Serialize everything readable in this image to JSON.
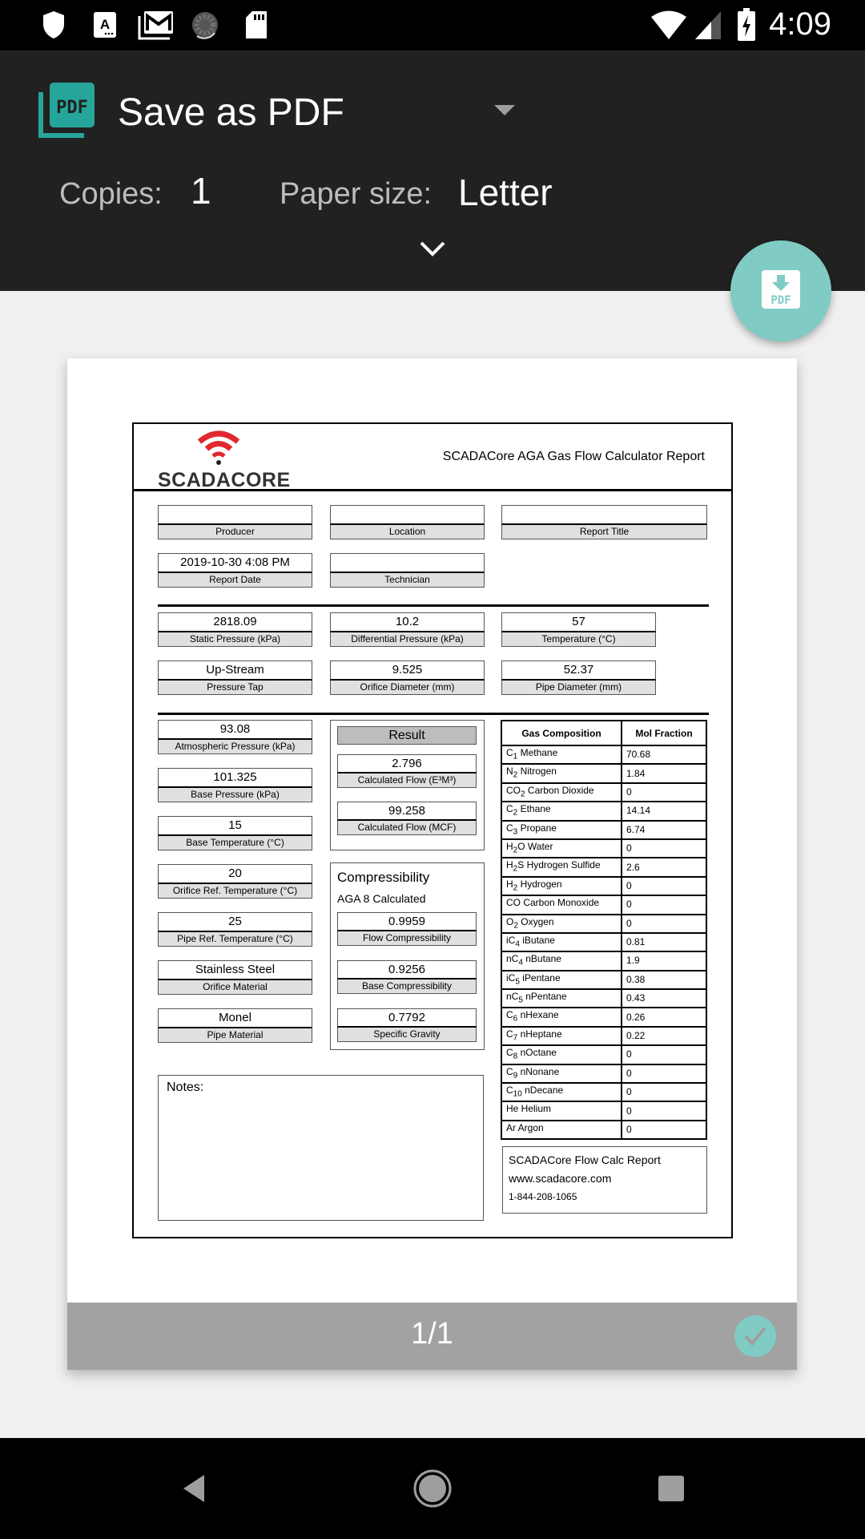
{
  "status_bar": {
    "time": "4:09",
    "left_icons": [
      "shield-icon",
      "font-a-icon",
      "gmail-icon",
      "sync-progress-icon",
      "sd-card-icon"
    ],
    "right_icons": [
      "wifi-icon",
      "cell-signal-icon",
      "battery-charging-icon"
    ]
  },
  "print_header": {
    "printer_name": "Save as PDF",
    "copies_label": "Copies:",
    "copies_value": "1",
    "paper_size_label": "Paper size:",
    "paper_size_value": "Letter",
    "fab_label": "PDF"
  },
  "colors": {
    "accent": "#80cbc4",
    "header_bg": "#212121",
    "pdf_icon": "#26a69a",
    "logo_red": "#e0282e"
  },
  "report": {
    "logo_text": "SCADACORE",
    "title": "SCADACore AGA Gas Flow Calculator Report",
    "info_fields": [
      {
        "value": "",
        "label": "Producer"
      },
      {
        "value": "",
        "label": "Location"
      },
      {
        "value": "",
        "label": "Report Title"
      },
      {
        "value": "2019-10-30  4:08 PM",
        "label": "Report Date"
      },
      {
        "value": "",
        "label": "Technician"
      }
    ],
    "measurement_fields": [
      {
        "value": "2818.09",
        "label": "Static Pressure (kPa)"
      },
      {
        "value": "10.2",
        "label": "Differential Pressure (kPa)"
      },
      {
        "value": "57",
        "label": "Temperature (°C)"
      },
      {
        "value": "Up-Stream",
        "label": "Pressure Tap"
      },
      {
        "value": "9.525",
        "label": "Orifice Diameter (mm)"
      },
      {
        "value": "52.37",
        "label": "Pipe Diameter (mm)"
      }
    ],
    "base_fields": [
      {
        "value": "93.08",
        "label": "Atmospheric Pressure (kPa)"
      },
      {
        "value": "101.325",
        "label": "Base Pressure (kPa)"
      },
      {
        "value": "15",
        "label": "Base Temperature (°C)"
      },
      {
        "value": "20",
        "label": "Orifice Ref. Temperature (°C)"
      },
      {
        "value": "25",
        "label": "Pipe Ref. Temperature (°C)"
      },
      {
        "value": "Stainless Steel",
        "label": "Orifice Material"
      },
      {
        "value": "Monel",
        "label": "Pipe Material"
      }
    ],
    "result": {
      "heading": "Result",
      "fields": [
        {
          "value": "2.796",
          "label": "Calculated Flow (E³M³)"
        },
        {
          "value": "99.258",
          "label": "Calculated Flow (MCF)"
        }
      ]
    },
    "compressibility": {
      "heading": "Compressibility",
      "subheading": "AGA 8 Calculated",
      "fields": [
        {
          "value": "0.9959",
          "label": "Flow Compressibility"
        },
        {
          "value": "0.9256",
          "label": "Base Compressibility"
        },
        {
          "value": "0.7792",
          "label": "Specific Gravity"
        }
      ]
    },
    "gas_table": {
      "headers": [
        "Gas Composition",
        "Mol Fraction"
      ],
      "rows": [
        {
          "sym": "C",
          "sub": "1",
          "name": " Methane",
          "value": "70.68"
        },
        {
          "sym": "N",
          "sub": "2",
          "name": " Nitrogen",
          "value": "1.84"
        },
        {
          "sym": "CO",
          "sub": "2",
          "name": " Carbon Dioxide",
          "value": "0"
        },
        {
          "sym": "C",
          "sub": "2",
          "name": " Ethane",
          "value": "14.14"
        },
        {
          "sym": "C",
          "sub": "3",
          "name": " Propane",
          "value": "6.74"
        },
        {
          "sym": "H",
          "sub": "2",
          "name": "O Water",
          "value": "0"
        },
        {
          "sym": "H",
          "sub": "2",
          "name": "S Hydrogen Sulfide",
          "value": "2.6"
        },
        {
          "sym": "H",
          "sub": "2",
          "name": " Hydrogen",
          "value": "0"
        },
        {
          "sym": "CO",
          "sub": "",
          "name": " Carbon Monoxide",
          "value": "0"
        },
        {
          "sym": "O",
          "sub": "2",
          "name": " Oxygen",
          "value": "0"
        },
        {
          "sym": "iC",
          "sub": "4",
          "name": " iButane",
          "value": "0.81"
        },
        {
          "sym": "nC",
          "sub": "4",
          "name": " nButane",
          "value": "1.9"
        },
        {
          "sym": "iC",
          "sub": "5",
          "name": " iPentane",
          "value": "0.38"
        },
        {
          "sym": "nC",
          "sub": "5",
          "name": " nPentane",
          "value": "0.43"
        },
        {
          "sym": "C",
          "sub": "6",
          "name": " nHexane",
          "value": "0.26"
        },
        {
          "sym": "C",
          "sub": "7",
          "name": " nHeptane",
          "value": "0.22"
        },
        {
          "sym": "C",
          "sub": "8",
          "name": " nOctane",
          "value": "0"
        },
        {
          "sym": "C",
          "sub": "9",
          "name": " nNonane",
          "value": "0"
        },
        {
          "sym": "C",
          "sub": "10",
          "name": " nDecane",
          "value": "0"
        },
        {
          "sym": "He",
          "sub": "",
          "name": " Helium",
          "value": "0"
        },
        {
          "sym": "Ar",
          "sub": "",
          "name": " Argon",
          "value": "0"
        }
      ]
    },
    "notes_label": "Notes:",
    "contact": {
      "line1": "SCADACore Flow Calc Report",
      "line2": "www.scadacore.com",
      "line3": "1-844-208-1065"
    }
  },
  "preview_footer": {
    "page_indicator": "1/1"
  },
  "nav_bar": {
    "buttons": [
      "back",
      "home",
      "recents"
    ]
  }
}
